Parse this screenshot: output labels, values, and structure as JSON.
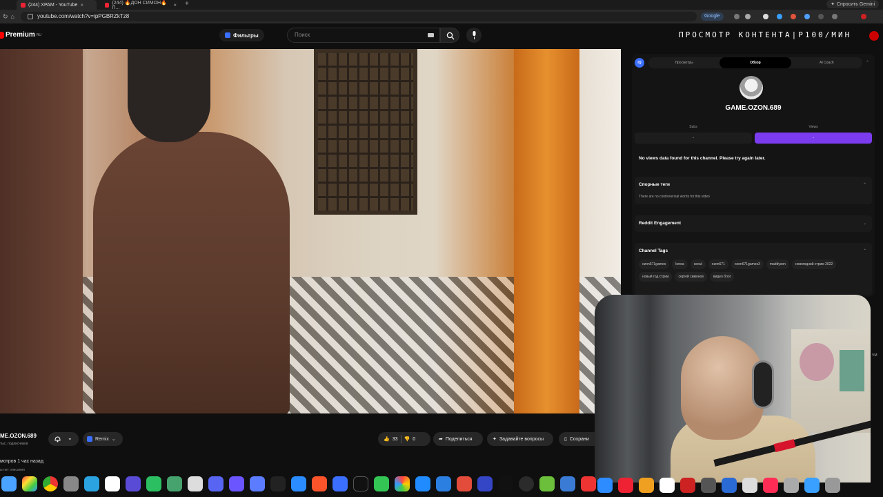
{
  "browser": {
    "tabs": [
      {
        "title": "(244) ХРАМ - YouTube"
      },
      {
        "title": "(244) 🔥ДОН СИМОН🔥 П..."
      }
    ],
    "new_tab": "+",
    "url": "youtube.com/watch?v=ipPGBRZkTz8",
    "google_chip": "Google",
    "gemini": "Спросить Gemini"
  },
  "youtube": {
    "logo_text": "Premium",
    "logo_sup": "RU",
    "filters_label": "Фильтры",
    "search_placeholder": "Поиск",
    "overlay_title": "ПРОСМОТР КОНТЕНТА|Р100/МИН"
  },
  "video_meta": {
    "channel_name": "ME.OZON.689",
    "subs_text": "тыс. подписчиков",
    "remix_label": "Remix",
    "likes": "33",
    "dislikes": "0",
    "share_label": "Поделиться",
    "ask_label": "Задавайте вопросы",
    "save_label": "Сохрани",
    "views_line": "мотров  1 час назад",
    "views_line2": "ы нет описания"
  },
  "panel": {
    "tabs": [
      "Просмотры",
      "Обзор",
      "AI Coach"
    ],
    "active_tab": 1,
    "channel": "GAME.OZON.689",
    "subs_label": "Subs",
    "views_label": "Views",
    "subs_value": "-",
    "views_value": "-",
    "no_data": "No views data found for this channel. Please try again later.",
    "controversial_title": "Спорные теги",
    "controversial_text": "There are no controversial words for this video",
    "reddit_title": "Reddit Engagement",
    "tags_title": "Channel Tags",
    "tags": [
      "ozon671games",
      "korea",
      "seoul",
      "ozon671",
      "ozon671games3",
      "maddyson",
      "новогодний стрим 2022",
      "новый год стрим",
      "сергей симонов",
      "видео блог"
    ]
  },
  "side_label": "VM",
  "colors": {
    "accent_purple": "#7b3cf0",
    "yt_red": "#ff0000",
    "panel_bg": "#141414"
  }
}
